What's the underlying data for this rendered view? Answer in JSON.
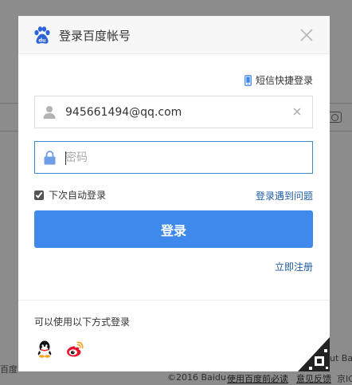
{
  "background": {
    "left_label": "百度",
    "right_fragment": "ut Ba",
    "footer_year": "©2016 Baidu",
    "footer_link1": "使用百度前必读",
    "footer_link2": "意见反馈",
    "footer_tail": "京IC"
  },
  "dialog": {
    "title": "登录百度帐号",
    "sms_login": "短信快捷登录",
    "username_value": "945661494@qq.com",
    "password_placeholder": "密码",
    "remember_label": "下次自动登录",
    "problem_link": "登录遇到问题",
    "login_button": "登录",
    "register_link": "立即注册",
    "other_methods_label": "可以使用以下方式登录"
  },
  "colors": {
    "primary": "#3f89ec",
    "link": "#1d5ca5",
    "focus_border": "#3d86d8"
  },
  "icons": [
    "baidu-paw-logo",
    "close-icon",
    "phone-icon",
    "user-icon",
    "lock-icon",
    "clear-icon",
    "qq-icon",
    "weibo-icon",
    "qr-corner-icon"
  ]
}
